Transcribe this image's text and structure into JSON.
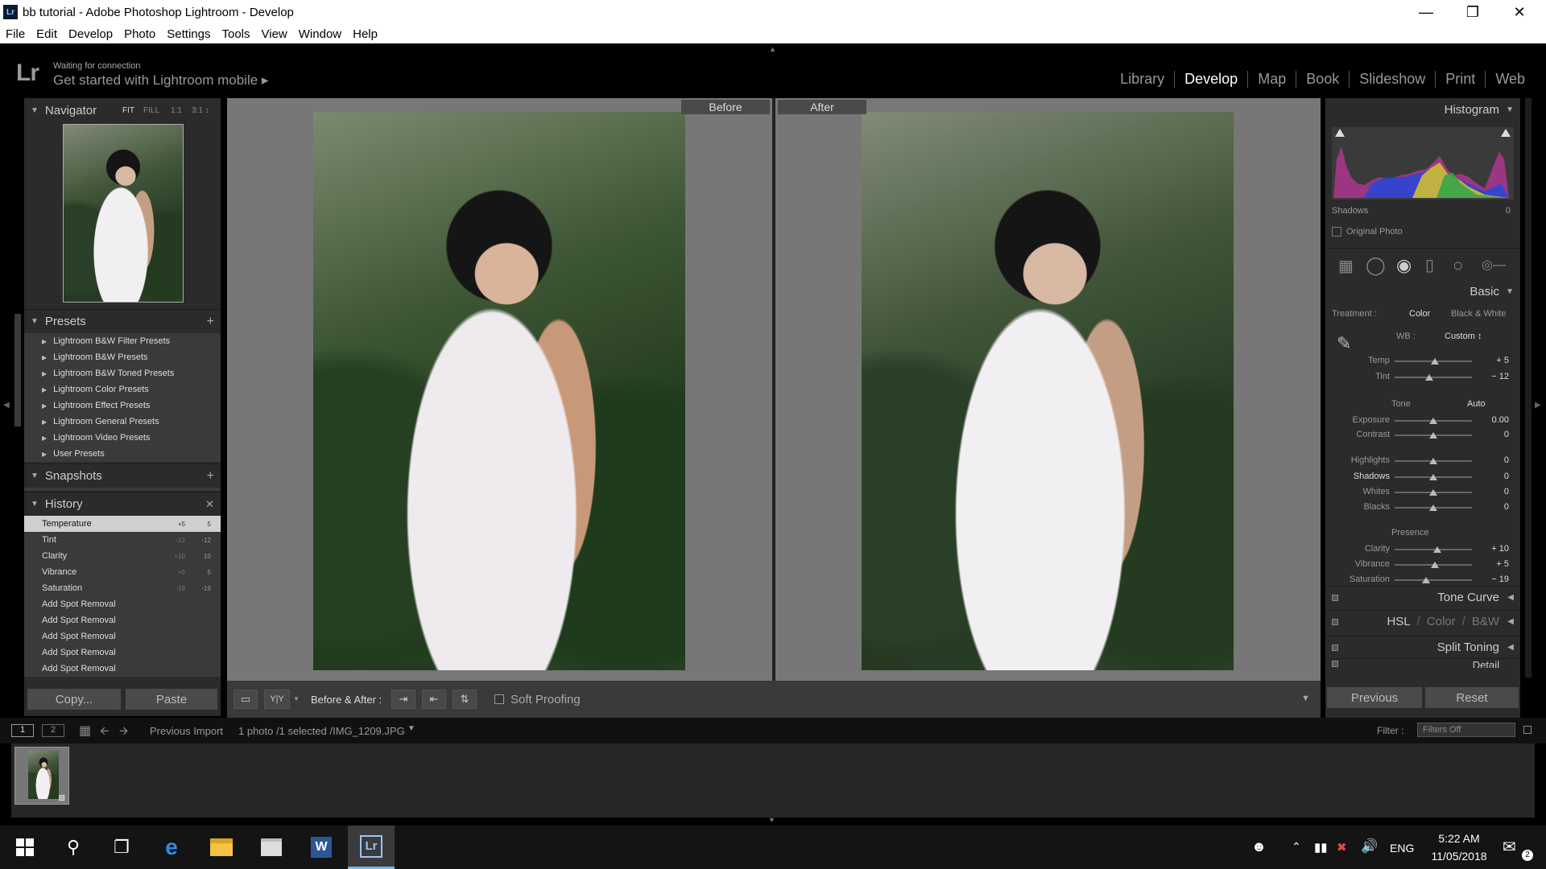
{
  "window": {
    "title": "bb tutorial - Adobe Photoshop Lightroom - Develop",
    "app_badge": "Lr"
  },
  "menu": [
    "File",
    "Edit",
    "Develop",
    "Photo",
    "Settings",
    "Tools",
    "View",
    "Window",
    "Help"
  ],
  "identity": {
    "logo": "Lr",
    "status": "Waiting for connection",
    "promo": "Get started with Lightroom mobile ▸"
  },
  "modules": [
    "Library",
    "Develop",
    "Map",
    "Book",
    "Slideshow",
    "Print",
    "Web"
  ],
  "active_module": "Develop",
  "navigator": {
    "title": "Navigator",
    "zoom_options": [
      "FIT",
      "FILL",
      "1:1",
      "3:1 ↕"
    ]
  },
  "presets": {
    "title": "Presets",
    "items": [
      "Lightroom B&W Filter Presets",
      "Lightroom B&W Presets",
      "Lightroom B&W Toned Presets",
      "Lightroom Color Presets",
      "Lightroom Effect Presets",
      "Lightroom General Presets",
      "Lightroom Video Presets",
      "User Presets"
    ]
  },
  "snapshots": {
    "title": "Snapshots"
  },
  "history": {
    "title": "History",
    "items": [
      {
        "label": "Temperature",
        "a": "+5",
        "b": "5"
      },
      {
        "label": "Tint",
        "a": "-12",
        "b": "-12"
      },
      {
        "label": "Clarity",
        "a": "+10",
        "b": "10"
      },
      {
        "label": "Vibrance",
        "a": "+5",
        "b": "5"
      },
      {
        "label": "Saturation",
        "a": "-19",
        "b": "-19"
      },
      {
        "label": "Add Spot Removal",
        "a": "",
        "b": ""
      },
      {
        "label": "Add Spot Removal",
        "a": "",
        "b": ""
      },
      {
        "label": "Add Spot Removal",
        "a": "",
        "b": ""
      },
      {
        "label": "Add Spot Removal",
        "a": "",
        "b": ""
      },
      {
        "label": "Add Spot Removal",
        "a": "",
        "b": ""
      }
    ]
  },
  "left_buttons": {
    "copy": "Copy...",
    "paste": "Paste"
  },
  "center": {
    "before_label": "Before",
    "after_label": "After"
  },
  "toolbar": {
    "ba_label": "Before & After :",
    "soft_proofing": "Soft Proofing",
    "view_mode": "Y|Y"
  },
  "histogram": {
    "title": "Histogram",
    "shadows_label": "Shadows",
    "shadows_value": "0",
    "original_photo": "Original Photo"
  },
  "basic": {
    "title": "Basic",
    "treatment_label": "Treatment :",
    "treatment_color": "Color",
    "treatment_bw": "Black & White",
    "wb_label": "WB :",
    "wb_value": "Custom ↕",
    "tone_label": "Tone",
    "auto_label": "Auto",
    "presence_label": "Presence",
    "sliders": [
      {
        "name": "Temp",
        "value": "+ 5",
        "pos": 0.52
      },
      {
        "name": "Tint",
        "value": "− 12",
        "pos": 0.45
      },
      {
        "name": "Exposure",
        "value": "0.00",
        "pos": 0.5
      },
      {
        "name": "Contrast",
        "value": "0",
        "pos": 0.5
      },
      {
        "name": "Highlights",
        "value": "0",
        "pos": 0.5
      },
      {
        "name": "Shadows",
        "value": "0",
        "pos": 0.5
      },
      {
        "name": "Whites",
        "value": "0",
        "pos": 0.5
      },
      {
        "name": "Blacks",
        "value": "0",
        "pos": 0.5
      },
      {
        "name": "Clarity",
        "value": "+ 10",
        "pos": 0.55
      },
      {
        "name": "Vibrance",
        "value": "+ 5",
        "pos": 0.52
      },
      {
        "name": "Saturation",
        "value": "− 19",
        "pos": 0.41
      }
    ]
  },
  "right_sections": {
    "tone_curve": "Tone Curve",
    "hsl": "HSL",
    "hsl_color": "Color",
    "hsl_bw": "B&W",
    "split_toning": "Split Toning",
    "detail": "Detail"
  },
  "right_buttons": {
    "previous": "Previous",
    "reset": "Reset"
  },
  "filmbar": {
    "page1": "1",
    "page2": "2",
    "source": "Previous Import",
    "info": "1 photo /1 selected /IMG_1209.JPG",
    "filter_label": "Filter :",
    "filter_value": "Filters Off"
  },
  "taskbar": {
    "time": "5:22 AM",
    "date": "11/05/2018",
    "lang": "ENG",
    "notif_count": "2"
  },
  "colors": {
    "accent_bg": "#2b2b2b",
    "panel_dark": "#000000"
  }
}
